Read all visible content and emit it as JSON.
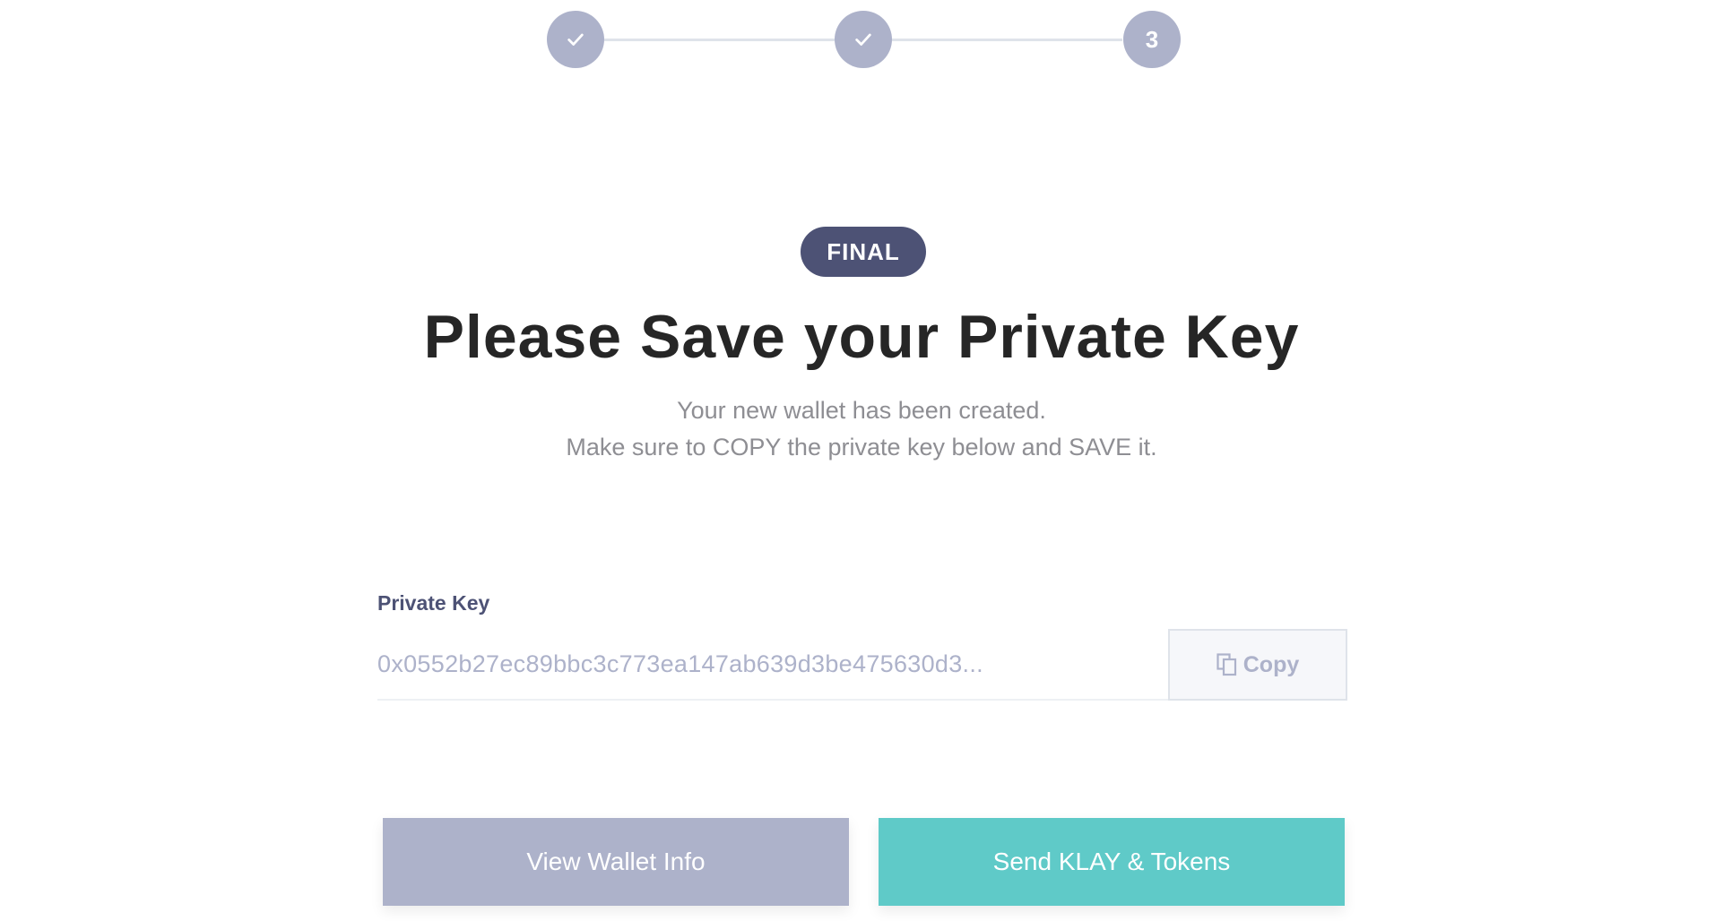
{
  "stepper": {
    "steps": [
      {
        "state": "done",
        "icon": "check-icon"
      },
      {
        "state": "done",
        "icon": "check-icon"
      },
      {
        "state": "current",
        "label": "3"
      }
    ],
    "color": "#adb2ca"
  },
  "badge": {
    "label": "FINAL",
    "color": "#4d5275"
  },
  "title": "Please Save your Private Key",
  "subtitle": {
    "line1": "Your new wallet has been created.",
    "line2": "Make sure to COPY the private key below and SAVE it."
  },
  "private_key": {
    "label": "Private Key",
    "value": "0x0552b27ec89bbc3c773ea147ab639d3be475630d3...",
    "copy_label": "Copy",
    "copy_icon": "copy-icon"
  },
  "actions": {
    "view_wallet_label": "View Wallet Info",
    "view_wallet_color": "#adb2ca",
    "send_label": "Send KLAY & Tokens",
    "send_color": "#5fcac8"
  }
}
